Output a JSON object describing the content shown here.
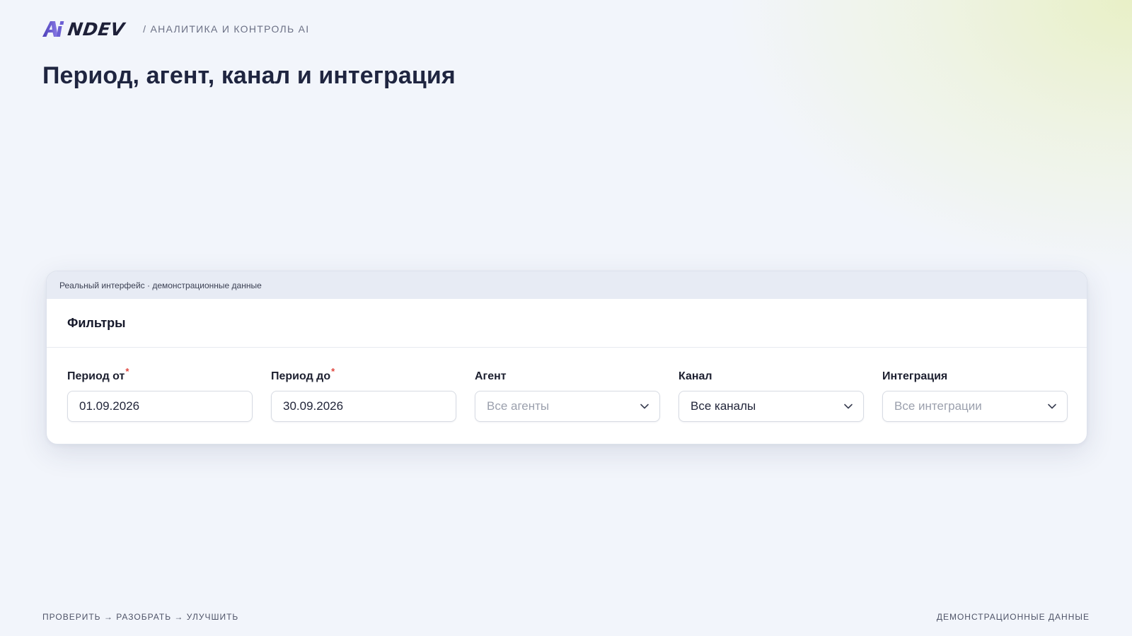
{
  "header": {
    "logo_text": "NDEV",
    "logo_mark_text": "Ai",
    "subtitle": "/ АНАЛИТИКА И КОНТРОЛЬ AI"
  },
  "page": {
    "title": "Период, агент, канал и интеграция"
  },
  "card": {
    "topbar_text": "Реальный интерфейс · демонстрационные данные",
    "heading": "Фильтры",
    "filters": [
      {
        "label": "Период от",
        "required": "*",
        "value": "01.09.2026",
        "kind": "date"
      },
      {
        "label": "Период до",
        "required": "*",
        "value": "30.09.2026",
        "kind": "date"
      },
      {
        "label": "Агент",
        "placeholder": "Все агенты",
        "kind": "select"
      },
      {
        "label": "Канал",
        "value": "Все каналы",
        "kind": "select"
      },
      {
        "label": "Интеграция",
        "placeholder": "Все интеграции",
        "kind": "select"
      }
    ]
  },
  "footer": {
    "left": "ПРОВЕРИТЬ → РАЗОБРАТЬ → УЛУЧШИТЬ",
    "right": "ДЕМОНСТРАЦИОННЫЕ ДАННЫЕ"
  },
  "colors": {
    "accent": "#6c5fd4",
    "title": "#1f2540",
    "required": "#e0463e"
  },
  "icons": {
    "select": "chevron-down-icon"
  }
}
